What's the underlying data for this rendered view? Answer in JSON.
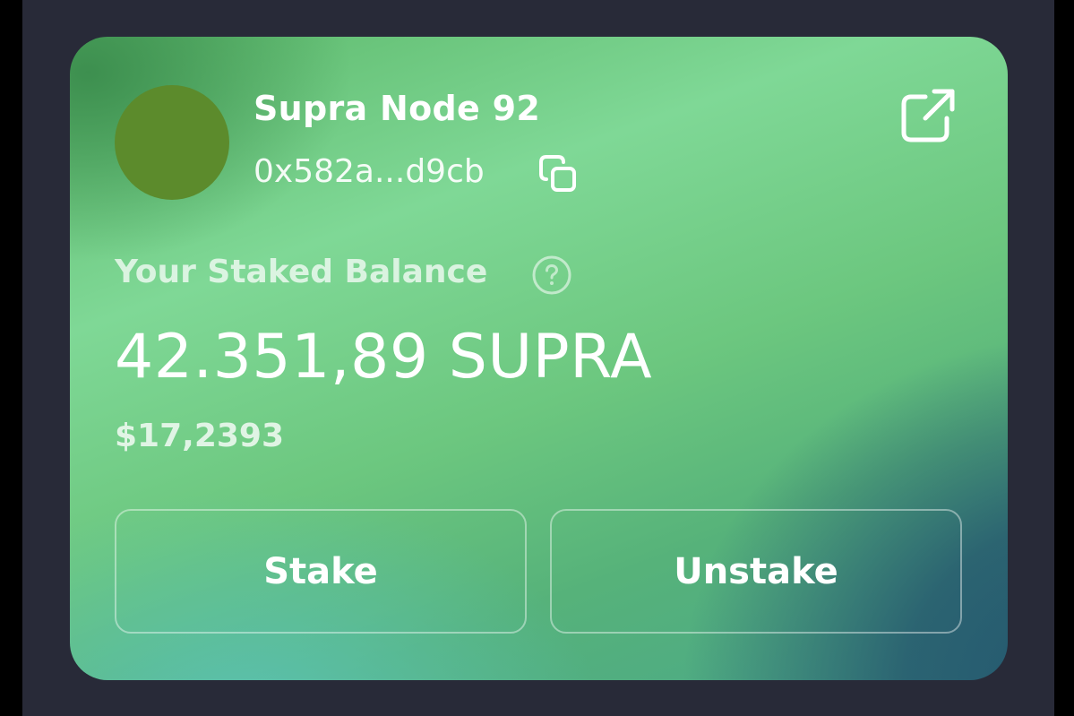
{
  "node": {
    "name": "Supra Node 92",
    "address": "0x582a...d9cb",
    "avatar_color": "#5c8b2c"
  },
  "icons": {
    "copy": "copy-icon",
    "external": "external-link-icon",
    "help": "help-circle-icon"
  },
  "balance": {
    "label": "Your Staked Balance",
    "amount": "42.351,89 SUPRA",
    "usd": "$17,2393"
  },
  "actions": {
    "stake_label": "Stake",
    "unstake_label": "Unstake"
  },
  "colors": {
    "background": "#282a38",
    "card_gradient_light": "#7fd896",
    "card_gradient_dark": "#23556f"
  }
}
